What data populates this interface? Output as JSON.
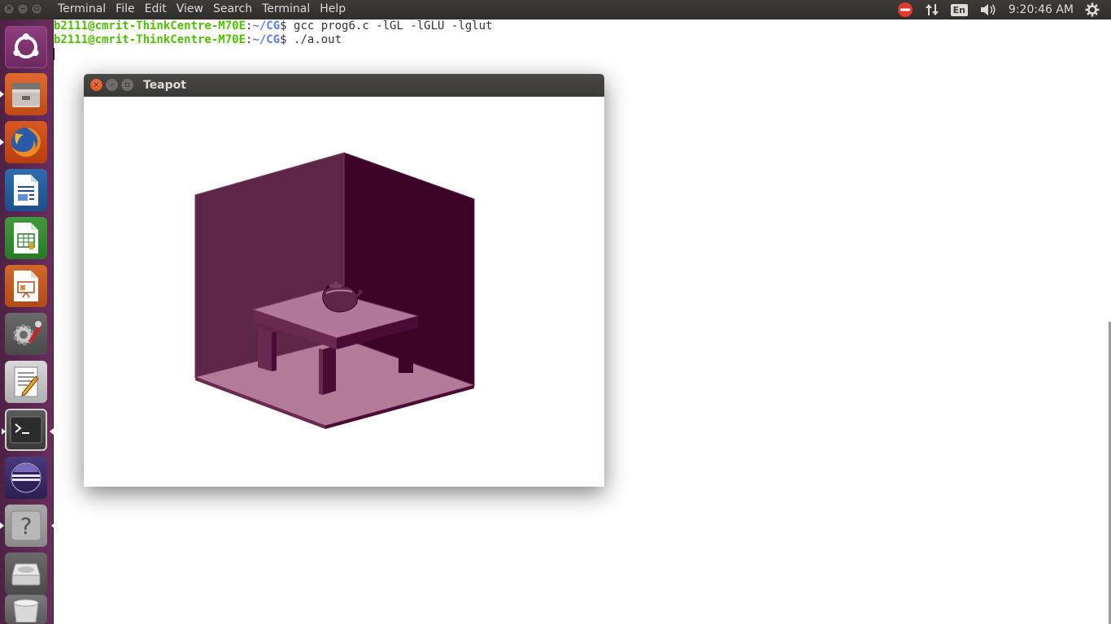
{
  "menubar": {
    "app_name": "Terminal",
    "items": [
      "File",
      "Edit",
      "View",
      "Search",
      "Terminal",
      "Help"
    ]
  },
  "indicators": {
    "language": "En",
    "clock": "9:20:46 AM"
  },
  "launcher": {
    "items": [
      {
        "name": "ubuntu-dash-icon"
      },
      {
        "name": "files-icon"
      },
      {
        "name": "firefox-icon"
      },
      {
        "name": "writer-icon"
      },
      {
        "name": "calc-icon"
      },
      {
        "name": "impress-icon"
      },
      {
        "name": "system-settings-icon"
      },
      {
        "name": "text-editor-icon"
      },
      {
        "name": "terminal-icon"
      },
      {
        "name": "eclipse-icon"
      },
      {
        "name": "help-icon"
      },
      {
        "name": "drive-icon"
      },
      {
        "name": "trash-icon"
      }
    ]
  },
  "terminal": {
    "lines": [
      {
        "user": "b2111@cmrit-ThinkCentre-M70E",
        "path": "~/CG",
        "prompt": "$",
        "command": " gcc prog6.c -lGL -lGLU -lglut"
      },
      {
        "user": "b2111@cmrit-ThinkCentre-M70E",
        "path": "~/CG",
        "prompt": "$",
        "command": " ./a.out"
      }
    ]
  },
  "teapot_window": {
    "title": "Teapot"
  },
  "colors": {
    "wall_left": "#5e2748",
    "wall_right": "#3c0528",
    "floor": "#b47b98",
    "table_top": "#b2789a",
    "launcher": "#5c2750"
  }
}
